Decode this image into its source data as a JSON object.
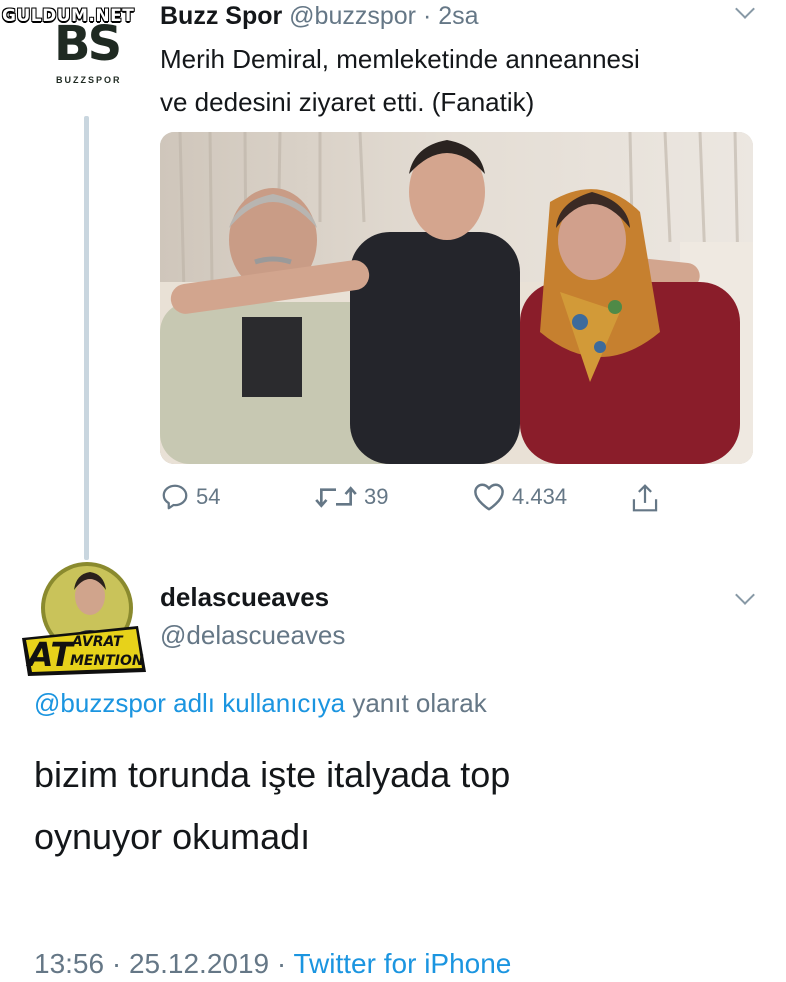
{
  "watermark": "GULDUM.NET",
  "tweet": {
    "avatar_letters": "BS",
    "avatar_sub": "BUZZSPOR",
    "author_name": "Buzz Spor",
    "author_handle": "@buzzspor",
    "separator": "·",
    "time": "2sa",
    "text_line1": "Merih Demiral, memleketinde anneannesi",
    "text_line2": "ve dedesini ziyaret etti. (Fanatik)",
    "replies": "54",
    "retweets": "39",
    "likes": "4.434"
  },
  "reply": {
    "avatar_badge_big": "AT",
    "avatar_badge_top": "AVRAT",
    "avatar_badge_bottom": "MENTION",
    "author_name": "delascueaves",
    "author_handle": "@delascueaves",
    "reply_to_user": "@buzzspor adlı kullanıcıya",
    "reply_to_suffix": " yanıt olarak",
    "text_line1": "bizim torunda işte italyada top",
    "text_line2": "oynuyor okumadı",
    "time": "13:56",
    "date": "25.12.2019",
    "separator": "·",
    "source": "Twitter for iPhone"
  },
  "colors": {
    "link": "#1b95e0",
    "muted": "#657786",
    "text": "#14171a"
  }
}
